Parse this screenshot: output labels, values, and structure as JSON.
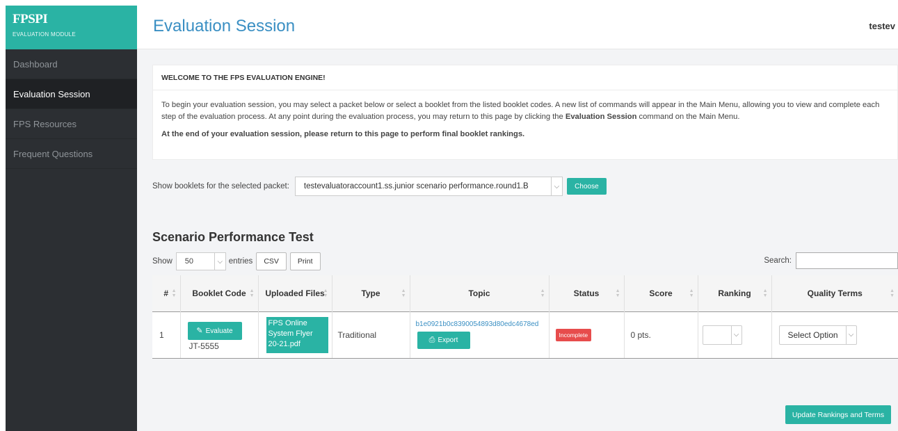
{
  "brand": {
    "logo": "FPSPI",
    "subtitle": "EVALUATION MODULE"
  },
  "sidebar": {
    "items": [
      {
        "label": "Dashboard",
        "active": false
      },
      {
        "label": "Evaluation Session",
        "active": true
      },
      {
        "label": "FPS Resources",
        "active": false
      },
      {
        "label": "Frequent Questions",
        "active": false
      }
    ]
  },
  "header": {
    "title": "Evaluation Session",
    "user": "testev"
  },
  "welcome": {
    "heading": "WELCOME TO THE FPS EVALUATION ENGINE!",
    "para1_a": "To begin your evaluation session, you may select a packet below or select a booklet from the listed booklet codes. A new list of commands will appear in the Main Menu, allowing you to view and complete each step of the evaluation process. At any point during the evaluation process, you may return to this page by clicking the ",
    "para1_bold": "Evaluation Session",
    "para1_b": " command on the Main Menu.",
    "para2": "At the end of your evaluation session, please return to this page to perform final booklet rankings."
  },
  "packet": {
    "label": "Show booklets for the selected packet:",
    "selected": "testevaluatoraccount1.ss.junior scenario performance.round1.B",
    "choose_label": "Choose"
  },
  "table_section": {
    "title": "Scenario Performance Test",
    "show_label": "Show",
    "entries_value": "50",
    "entries_label": "entries",
    "csv_label": "CSV",
    "print_label": "Print",
    "search_label": "Search:",
    "columns": [
      "#",
      "Booklet Code",
      "Uploaded Files",
      "Type",
      "Topic",
      "Status",
      "Score",
      "Ranking",
      "Quality Terms"
    ],
    "rows": [
      {
        "num": "1",
        "evaluate_label": "Evaluate",
        "booklet_code": "JT-5555",
        "file": "FPS Online System Flyer 20-21.pdf",
        "type": "Traditional",
        "topic_hash": "b1e0921b0c8390054893d80edc4678ed",
        "export_label": "Export",
        "status": "Incomplete",
        "score": "0 pts.",
        "ranking": "",
        "quality": "Select Option"
      }
    ]
  },
  "update_label": "Update Rankings and Terms",
  "colors": {
    "accent": "#2ab3a4",
    "title_blue": "#3a8fc3",
    "sidebar_bg": "#2c2f33",
    "incomplete_red": "#e74c4c"
  },
  "icons": {
    "evaluate": "pencil-icon",
    "export": "export-icon",
    "dropdown": "chevron-down-icon",
    "sort": "sort-icon"
  }
}
